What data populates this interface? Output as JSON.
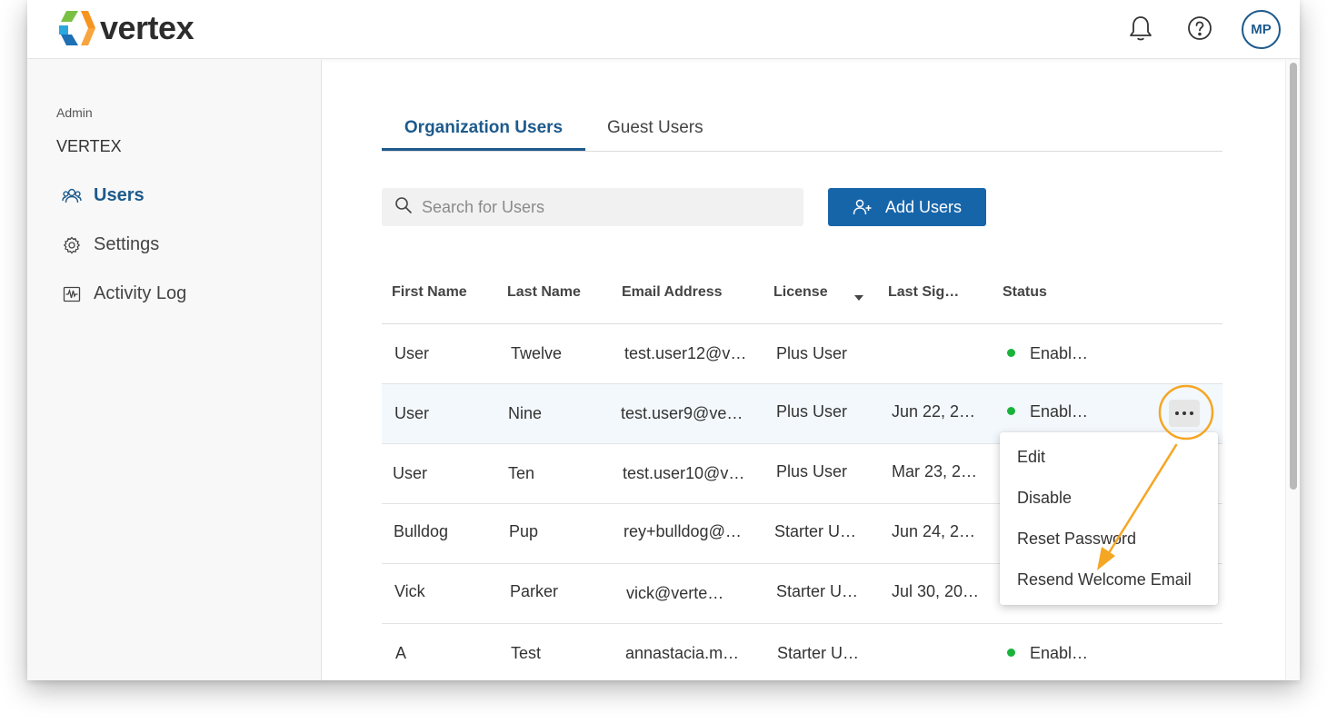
{
  "app": {
    "logo_text": "vertex",
    "avatar_initials": "MP"
  },
  "sidebar": {
    "section_label": "Admin",
    "org_name": "VERTEX",
    "items": [
      {
        "label": "Users",
        "icon": "users-icon",
        "active": true
      },
      {
        "label": "Settings",
        "icon": "gear-icon",
        "active": false
      },
      {
        "label": "Activity Log",
        "icon": "activity-icon",
        "active": false
      }
    ]
  },
  "tabs": [
    {
      "label": "Organization Users",
      "active": true
    },
    {
      "label": "Guest Users",
      "active": false
    }
  ],
  "search": {
    "placeholder": "Search for Users",
    "value": ""
  },
  "add_button": {
    "label": "Add Users"
  },
  "table": {
    "columns": [
      "First Name",
      "Last Name",
      "Email Address",
      "License",
      "Last Sig…",
      "Status"
    ],
    "rows": [
      {
        "first": "User",
        "last": "Twelve",
        "email": "test.user12@v…",
        "license": "Plus User",
        "last_sign": "",
        "status": "Enabl…"
      },
      {
        "first": "User",
        "last": "Nine",
        "email": "test.user9@ve…",
        "license": "Plus User",
        "last_sign": "Jun 22, 2…",
        "status": "Enabl…"
      },
      {
        "first": "User",
        "last": "Ten",
        "email": "test.user10@v…",
        "license": "Plus User",
        "last_sign": "Mar 23, 2…",
        "status": ""
      },
      {
        "first": "Bulldog",
        "last": "Pup",
        "email": "rey+bulldog@…",
        "license": "Starter U…",
        "last_sign": "Jun 24, 2…",
        "status": ""
      },
      {
        "first": "Vick",
        "last": "Parker",
        "email": "vick@verte…",
        "license": "Starter U…",
        "last_sign": "Jul 30, 20…",
        "status": ""
      },
      {
        "first": "A",
        "last": "Test",
        "email": "annastacia.m…",
        "license": "Starter U…",
        "last_sign": "",
        "status": "Enabl…"
      }
    ]
  },
  "context_menu": {
    "items": [
      "Edit",
      "Disable",
      "Reset Password",
      "Resend Welcome Email"
    ]
  },
  "colors": {
    "brand": "#1765a9",
    "status_enabled": "#19b23b",
    "annotation": "#f5a623"
  }
}
